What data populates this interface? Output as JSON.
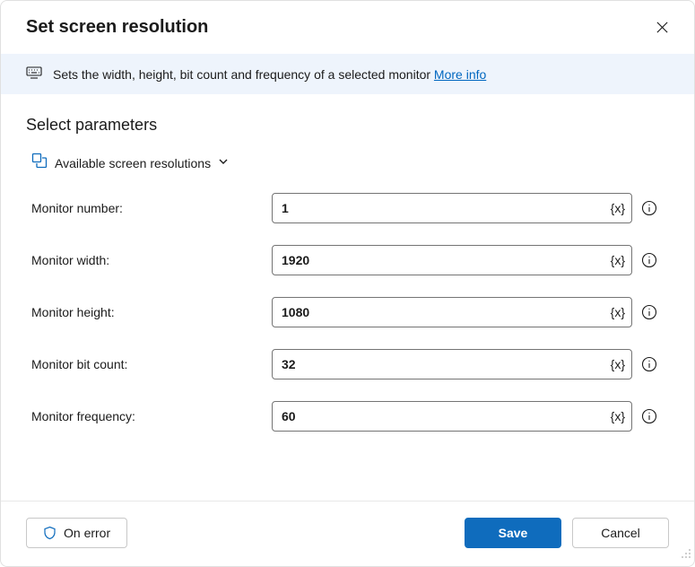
{
  "header": {
    "title": "Set screen resolution"
  },
  "banner": {
    "text": "Sets the width, height, bit count and frequency of a selected monitor ",
    "link": "More info"
  },
  "section": {
    "title": "Select parameters",
    "variables_label": "Available screen resolutions"
  },
  "fields": {
    "monitor_number": {
      "label": "Monitor number:",
      "value": "1"
    },
    "monitor_width": {
      "label": "Monitor width:",
      "value": "1920"
    },
    "monitor_height": {
      "label": "Monitor height:",
      "value": "1080"
    },
    "monitor_bit_count": {
      "label": "Monitor bit count:",
      "value": "32"
    },
    "monitor_frequency": {
      "label": "Monitor frequency:",
      "value": "60"
    }
  },
  "input_suffix": "{x}",
  "footer": {
    "on_error": "On error",
    "save": "Save",
    "cancel": "Cancel"
  }
}
